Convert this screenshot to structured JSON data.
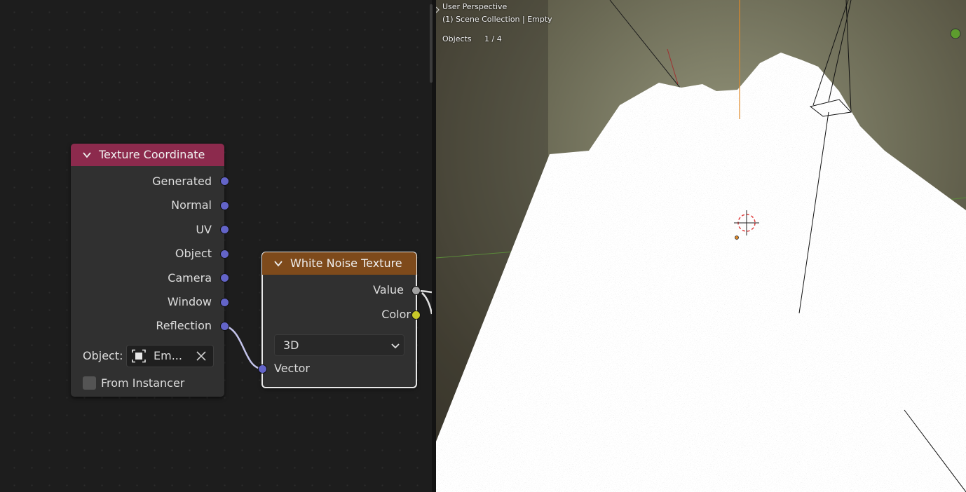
{
  "node_editor": {
    "texture_coordinate": {
      "title": "Texture Coordinate",
      "outputs": [
        "Generated",
        "Normal",
        "UV",
        "Object",
        "Camera",
        "Window",
        "Reflection"
      ],
      "object_label": "Object:",
      "object_value": "Em...",
      "from_instancer": "From Instancer"
    },
    "white_noise": {
      "title": "White Noise Texture",
      "outputs": [
        "Value",
        "Color"
      ],
      "dimensions": "3D",
      "input_vector": "Vector"
    }
  },
  "viewport": {
    "view_name": "User Perspective",
    "collection": "(1) Scene Collection | Empty",
    "objects_label": "Objects",
    "objects_count": "1 / 4"
  },
  "colors": {
    "socket_vector": "#6364c8",
    "socket_value": "#a1a1a1",
    "socket_color": "#c7c729",
    "texture_coordinate_header": "#8c2a4d",
    "white_noise_header": "#7e4a1b"
  }
}
